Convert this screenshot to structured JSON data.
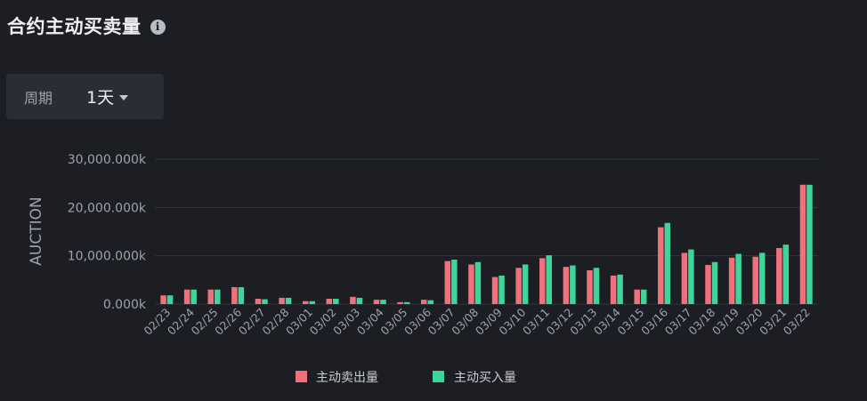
{
  "header": {
    "title": "合约主动买卖量",
    "info_icon": "info-icon"
  },
  "period": {
    "label": "周期",
    "value": "1天"
  },
  "colors": {
    "sell": "#f0707c",
    "buy": "#3fd49a",
    "grid": "#34363e"
  },
  "chart_data": {
    "type": "bar",
    "ylabel": "AUCTION",
    "ylim": [
      0,
      30000
    ],
    "yticks": [
      0,
      10000,
      20000,
      30000
    ],
    "ytick_labels": [
      "0.000k",
      "10,000.000k",
      "20,000.000k",
      "30,000.000k"
    ],
    "grid": true,
    "legend_position": "bottom",
    "categories": [
      "02/23",
      "02/24",
      "02/25",
      "02/26",
      "02/27",
      "02/28",
      "03/01",
      "03/02",
      "03/03",
      "03/04",
      "03/05",
      "03/06",
      "03/07",
      "03/08",
      "03/09",
      "03/10",
      "03/11",
      "03/12",
      "03/13",
      "03/14",
      "03/15",
      "03/16",
      "03/17",
      "03/18",
      "03/19",
      "03/20",
      "03/21",
      "03/22"
    ],
    "series": [
      {
        "name": "主动卖出量",
        "values": [
          1800,
          3000,
          3000,
          3500,
          1100,
          1300,
          600,
          1100,
          1500,
          900,
          400,
          900,
          8900,
          8200,
          5600,
          7500,
          9500,
          7700,
          7000,
          5900,
          3000,
          15900,
          10600,
          8100,
          9600,
          9800,
          11600,
          24700
        ]
      },
      {
        "name": "主动买入量",
        "values": [
          1800,
          3000,
          3000,
          3500,
          1000,
          1300,
          600,
          1100,
          1300,
          900,
          400,
          800,
          9200,
          8700,
          5900,
          8200,
          10100,
          8000,
          7500,
          6100,
          3000,
          16800,
          11300,
          8700,
          10400,
          10600,
          12300,
          24700
        ]
      }
    ]
  }
}
